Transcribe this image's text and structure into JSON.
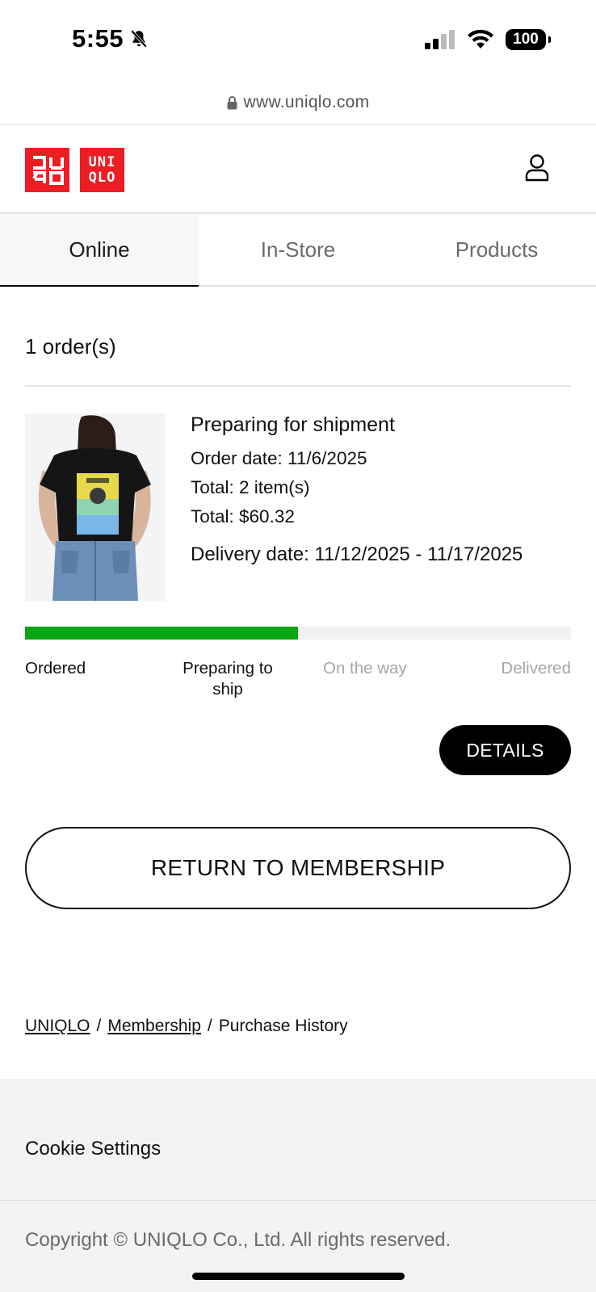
{
  "status_bar": {
    "time": "5:55",
    "battery": "100"
  },
  "browser": {
    "url": "www.uniqlo.com"
  },
  "header": {
    "logo_left": "ユニクロ",
    "logo_right_line1": "UNI",
    "logo_right_line2": "QLO"
  },
  "tabs": [
    {
      "label": "Online",
      "active": true
    },
    {
      "label": "In-Store",
      "active": false
    },
    {
      "label": "Products",
      "active": false
    }
  ],
  "orders": {
    "count_label": "1 order(s)",
    "items": [
      {
        "status": "Preparing for shipment",
        "order_date": "Order date: 11/6/2025",
        "item_count": "Total: 2 item(s)",
        "total": "Total: $60.32",
        "delivery": "Delivery date: 11/12/2025 - 11/17/2025",
        "progress_fraction": 0.5,
        "steps": [
          {
            "label": "Ordered",
            "done": true
          },
          {
            "label": "Preparing to ship",
            "done": true
          },
          {
            "label": "On the way",
            "done": false
          },
          {
            "label": "Delivered",
            "done": false
          }
        ],
        "details_label": "DETAILS"
      }
    ]
  },
  "return_button": "RETURN TO MEMBERSHIP",
  "breadcrumb": {
    "home": "UNIQLO",
    "membership": "Membership",
    "current": "Purchase History",
    "separator": "/"
  },
  "footer": {
    "cookie_settings": "Cookie Settings",
    "copyright": "Copyright © UNIQLO Co., Ltd. All rights reserved."
  },
  "colors": {
    "brand_red": "#ed1d24",
    "progress_green": "#0aa512"
  }
}
